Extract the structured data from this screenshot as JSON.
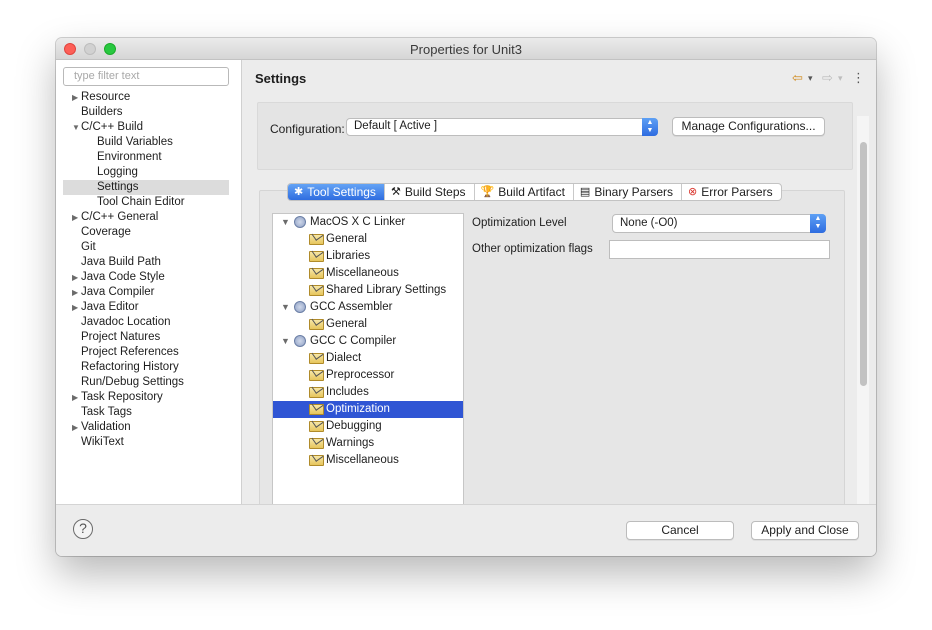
{
  "window": {
    "title": "Properties for Unit3"
  },
  "filter": {
    "placeholder": "type filter text"
  },
  "sidebar": {
    "items": [
      {
        "label": "Resource",
        "arrow": "▶"
      },
      {
        "label": "Builders",
        "arrow": ""
      },
      {
        "label": "C/C++ Build",
        "arrow": "▼"
      },
      {
        "label": "Build Variables",
        "arrow": ""
      },
      {
        "label": "Environment",
        "arrow": ""
      },
      {
        "label": "Logging",
        "arrow": ""
      },
      {
        "label": "Settings",
        "arrow": ""
      },
      {
        "label": "Tool Chain Editor",
        "arrow": ""
      },
      {
        "label": "C/C++ General",
        "arrow": "▶"
      },
      {
        "label": "Coverage",
        "arrow": ""
      },
      {
        "label": "Git",
        "arrow": ""
      },
      {
        "label": "Java Build Path",
        "arrow": ""
      },
      {
        "label": "Java Code Style",
        "arrow": "▶"
      },
      {
        "label": "Java Compiler",
        "arrow": "▶"
      },
      {
        "label": "Java Editor",
        "arrow": "▶"
      },
      {
        "label": "Javadoc Location",
        "arrow": ""
      },
      {
        "label": "Project Natures",
        "arrow": ""
      },
      {
        "label": "Project References",
        "arrow": ""
      },
      {
        "label": "Refactoring History",
        "arrow": ""
      },
      {
        "label": "Run/Debug Settings",
        "arrow": ""
      },
      {
        "label": "Task Repository",
        "arrow": "▶"
      },
      {
        "label": "Task Tags",
        "arrow": ""
      },
      {
        "label": "Validation",
        "arrow": "▶"
      },
      {
        "label": "WikiText",
        "arrow": ""
      }
    ]
  },
  "header": {
    "title": "Settings",
    "back_icon": "⇦",
    "forward_icon": "⇨",
    "menu_icon": "⋮",
    "dropdown": "▾"
  },
  "configuration": {
    "label": "Configuration:",
    "value": "Default  [ Active ]",
    "manage_label": "Manage Configurations..."
  },
  "tabs": [
    {
      "label": "Tool Settings",
      "icon": "✱"
    },
    {
      "label": "Build Steps",
      "icon": "⚒"
    },
    {
      "label": "Build Artifact",
      "icon": "🏆"
    },
    {
      "label": "Binary Parsers",
      "icon": "▤"
    },
    {
      "label": "Error Parsers",
      "icon": "⊗"
    }
  ],
  "tool_tree": [
    {
      "label": "MacOS X C Linker",
      "level": 0
    },
    {
      "label": "General",
      "level": 1
    },
    {
      "label": "Libraries",
      "level": 1
    },
    {
      "label": "Miscellaneous",
      "level": 1
    },
    {
      "label": "Shared Library Settings",
      "level": 1
    },
    {
      "label": "GCC Assembler",
      "level": 0
    },
    {
      "label": "General",
      "level": 1
    },
    {
      "label": "GCC C Compiler",
      "level": 0
    },
    {
      "label": "Dialect",
      "level": 1
    },
    {
      "label": "Preprocessor",
      "level": 1
    },
    {
      "label": "Includes",
      "level": 1
    },
    {
      "label": "Optimization",
      "level": 1
    },
    {
      "label": "Debugging",
      "level": 1
    },
    {
      "label": "Warnings",
      "level": 1
    },
    {
      "label": "Miscellaneous",
      "level": 1
    }
  ],
  "optimization": {
    "level_label": "Optimization Level",
    "level_value": "None (-O0)",
    "flags_label": "Other optimization flags",
    "flags_value": ""
  },
  "footer": {
    "help_icon": "?",
    "cancel_label": "Cancel",
    "apply_label": "Apply and Close"
  }
}
